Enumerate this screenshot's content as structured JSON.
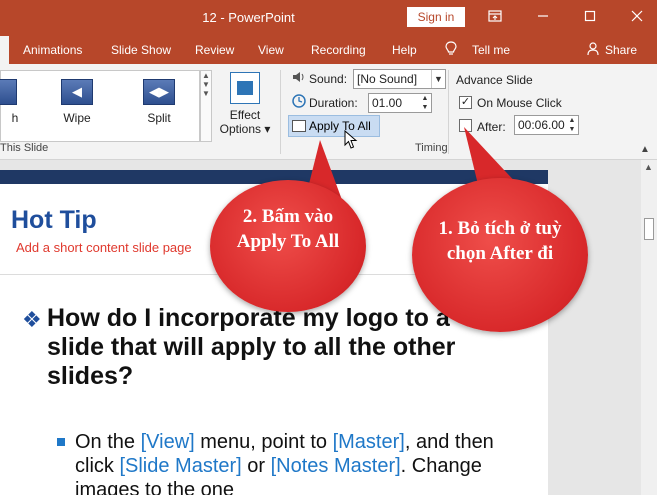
{
  "titlebar": {
    "title": "12  -  PowerPoint",
    "signin_label": "Sign in",
    "buttons": [
      "restore-ribbon-icon",
      "minimize-icon",
      "maximize-icon",
      "close-icon"
    ]
  },
  "tabs": [
    "Animations",
    "Slide Show",
    "Review",
    "View",
    "Recording",
    "Help"
  ],
  "tell_me": "Tell me",
  "share": "Share",
  "ribbon": {
    "partial_gallery_label": "h",
    "transitions": [
      "Wipe",
      "Split"
    ],
    "effect_options_line1": "Effect",
    "effect_options_line2": "Options ▾",
    "group_left_label": "This Slide",
    "sound_label": "Sound:",
    "sound_value": "[No Sound]",
    "duration_label": "Duration:",
    "duration_value": "01.00",
    "apply_to_all": "Apply To All",
    "advance_slide": "Advance Slide",
    "on_mouse_click": "On Mouse Click",
    "on_mouse_click_checked": true,
    "after_label": "After:",
    "after_checked": false,
    "after_value": "00:06.00",
    "timing_group": "Timing"
  },
  "slide": {
    "title": "Hot Tip",
    "subtitle": "Add a short content slide page",
    "question": "How do I incorporate my logo to a slide that will apply to all the other slides?",
    "answer_parts": [
      "On the ",
      "[View]",
      " menu, point to ",
      "[Master]",
      ", and then click ",
      "[Slide Master]",
      " or ",
      "[Notes Master]",
      ". Change images to the one"
    ]
  },
  "callouts": {
    "step2": "2. Bấm vào Apply To All",
    "step1": "1. Bỏ tích ở tuỳ chọn After đi"
  },
  "colors": {
    "ppt_red": "#b7472a",
    "callout_red": "#d8282a",
    "slide_title_blue": "#1f4e9c",
    "link_blue": "#1f78c8",
    "subtitle_red": "#e0392e"
  }
}
